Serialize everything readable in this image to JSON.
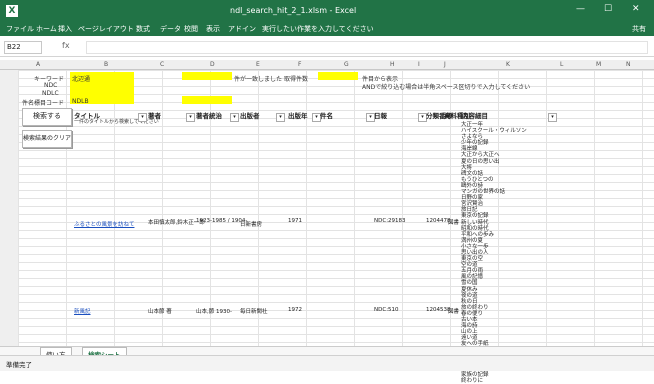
{
  "window": {
    "title": "ndl_search_hit_2_1.xlsm - Excel",
    "share": "共有"
  },
  "ribbon": {
    "tabs": [
      "ファイル",
      "ホーム",
      "挿入",
      "ページレイアウト",
      "数式",
      "データ",
      "校閲",
      "表示",
      "アドイン",
      "実行したい作業を入力してください"
    ]
  },
  "formula_bar": {
    "name_box": "B22",
    "fx_label": "fx",
    "value": ""
  },
  "column_headers": [
    "A",
    "B",
    "C",
    "D",
    "E",
    "F",
    "G",
    "H",
    "I",
    "J",
    "K",
    "L",
    "M",
    "N"
  ],
  "search_form": {
    "keyword_label": "キーワード",
    "ndc_label": "NDC",
    "ndlc_label": "NDLC",
    "heading_label": "件名標目コード",
    "keyword_value": "北辺通",
    "heading_value": "NDLB",
    "total_label": "件が一致しました",
    "count_label": "取得件数",
    "page_label": "件目から表示",
    "note": "ANDで絞り込む場合は半角スペース区切りで入力してください"
  },
  "buttons": {
    "search": "検索する",
    "clear": "検索結果のクリア"
  },
  "table": {
    "headers": [
      "タイトル",
      "著者",
      "著者統治",
      "出版者",
      "出版年",
      "件名",
      "日報",
      "分類番号",
      "資料種別",
      "内容細目"
    ],
    "title_subnote": "一件のタイトルから検索してください",
    "rows": [
      {
        "title": "ふるさとの風景を訪ねて",
        "author": "本田慎太郎,鈴木正一郎",
        "author_detail": "1923-1985 / 1904-",
        "publisher": "日新書房",
        "year": "1971",
        "date": "NDC:29183",
        "class": "1204478",
        "type": "図書"
      },
      {
        "title": "新風記",
        "author": "山本節 著",
        "author_detail": "山本,節 1930-",
        "publisher": "毎日新聞社",
        "year": "1972",
        "date": "NDC:510",
        "class": "1204538",
        "type": "図書"
      }
    ],
    "contents": [
      "大正一年",
      "ハイスクール・ウィルソン",
      "さよなら",
      "少年の記録",
      "海岸線",
      "大正から大正へ",
      "夏の日の思い出",
      "大将",
      "碑文の話",
      "もうひとつの",
      "鷗外の詩",
      "マンガの世界の話",
      "日野の家",
      "宮沢賢治",
      "旅日記",
      "東京の記録",
      "新しい時代",
      "昭和の時代",
      "平和への歩み",
      "満州の夏",
      "小さな一歩",
      "思い出の人",
      "東京の空",
      "空の道",
      "五月の雨",
      "風の記憶",
      "雪の国",
      "夏休み",
      "夜の道",
      "秋の日",
      "旅の終わり",
      "春の便り",
      "古い本",
      "海の詩",
      "山の上",
      "遠い道",
      "友への手紙",
      "冬の星",
      "心の風景",
      "父の思い出",
      "母の言葉",
      "家族の記録",
      "終わりに"
    ]
  },
  "sheets": {
    "tabs": [
      "使い方",
      "検索シート"
    ],
    "active": "検索シート"
  },
  "status": {
    "mode": "準備完了"
  }
}
